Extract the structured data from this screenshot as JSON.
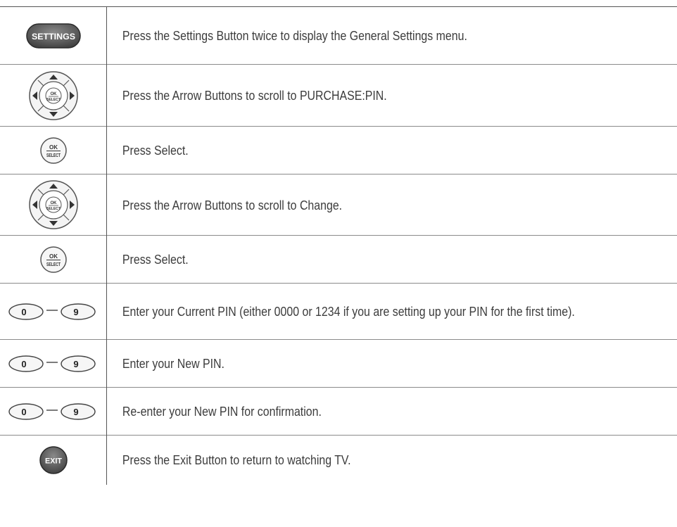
{
  "rows": [
    {
      "icon": "settings-button-icon",
      "icon_label": "SETTINGS",
      "text": "Press the Settings Button twice to display the General Settings menu."
    },
    {
      "icon": "arrow-pad-icon",
      "icon_label": "OK SELECT",
      "text": "Press the Arrow Buttons to scroll to PURCHASE:PIN."
    },
    {
      "icon": "select-button-icon",
      "icon_label": "OK SELECT",
      "text": "Press Select."
    },
    {
      "icon": "arrow-pad-icon",
      "icon_label": "OK SELECT",
      "text": "Press the Arrow Buttons to scroll to Change."
    },
    {
      "icon": "select-button-icon",
      "icon_label": "OK SELECT",
      "text": "Press Select."
    },
    {
      "icon": "number-keys-icon",
      "icon_label": "0 – 9",
      "text": "Enter your Current PIN (either 0000 or 1234 if you are setting up your PIN for the first time)."
    },
    {
      "icon": "number-keys-icon",
      "icon_label": "0 – 9",
      "text": "Enter your New PIN."
    },
    {
      "icon": "number-keys-icon",
      "icon_label": "0 – 9",
      "text": "Re-enter your New PIN for confirmation."
    },
    {
      "icon": "exit-button-icon",
      "icon_label": "EXIT",
      "text": "Press the Exit Button to return to watching TV."
    }
  ],
  "labels": {
    "settings": "SETTINGS",
    "ok": "OK",
    "select": "SELECT",
    "zero": "0",
    "nine": "9",
    "exit": "EXIT"
  },
  "colors": {
    "button_dark": "#5a5a5a",
    "button_light": "#f2f2f2",
    "rule": "#8a8a8a"
  }
}
